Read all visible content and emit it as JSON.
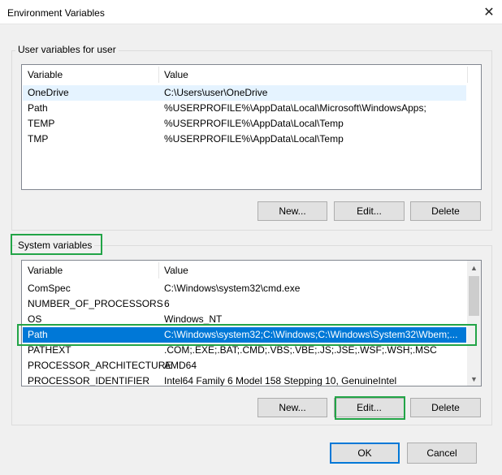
{
  "window": {
    "title": "Environment Variables",
    "close_glyph": "✕"
  },
  "user_vars": {
    "group_label": "User variables for user",
    "columns": [
      "Variable",
      "Value"
    ],
    "rows": [
      {
        "name": "OneDrive",
        "value": "C:\\Users\\user\\OneDrive"
      },
      {
        "name": "Path",
        "value": "%USERPROFILE%\\AppData\\Local\\Microsoft\\WindowsApps;"
      },
      {
        "name": "TEMP",
        "value": "%USERPROFILE%\\AppData\\Local\\Temp"
      },
      {
        "name": "TMP",
        "value": "%USERPROFILE%\\AppData\\Local\\Temp"
      }
    ],
    "buttons": {
      "new": "New...",
      "edit": "Edit...",
      "delete": "Delete"
    }
  },
  "system_vars": {
    "group_label": "System variables",
    "columns": [
      "Variable",
      "Value"
    ],
    "rows": [
      {
        "name": "ComSpec",
        "value": "C:\\Windows\\system32\\cmd.exe"
      },
      {
        "name": "NUMBER_OF_PROCESSORS",
        "value": "6"
      },
      {
        "name": "OS",
        "value": "Windows_NT"
      },
      {
        "name": "Path",
        "value": "C:\\Windows\\system32;C:\\Windows;C:\\Windows\\System32\\Wbem;..."
      },
      {
        "name": "PATHEXT",
        "value": ".COM;.EXE;.BAT;.CMD;.VBS;.VBE;.JS;.JSE;.WSF;.WSH;.MSC"
      },
      {
        "name": "PROCESSOR_ARCHITECTURE",
        "value": "AMD64"
      },
      {
        "name": "PROCESSOR_IDENTIFIER",
        "value": "Intel64 Family 6 Model 158 Stepping 10, GenuineIntel"
      }
    ],
    "buttons": {
      "new": "New...",
      "edit": "Edit...",
      "delete": "Delete"
    }
  },
  "dialog_buttons": {
    "ok": "OK",
    "cancel": "Cancel"
  },
  "colors": {
    "selection": "#0078d7",
    "hover_row": "#e5f3ff",
    "annotation": "#22a447"
  }
}
